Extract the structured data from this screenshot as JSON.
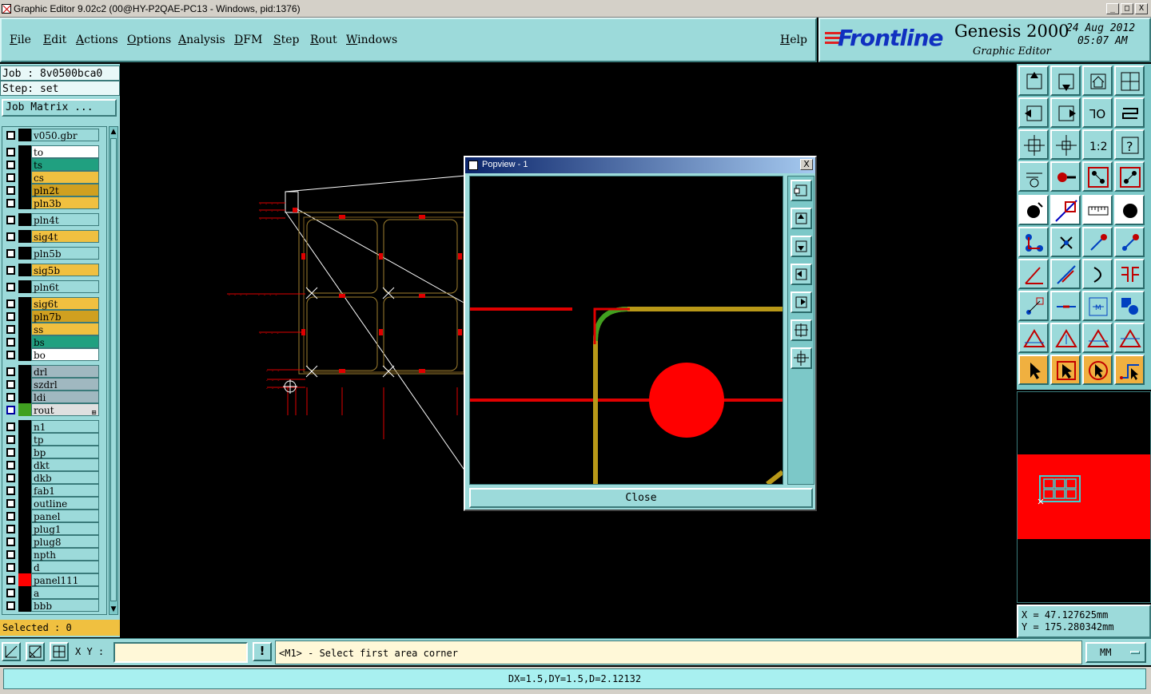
{
  "window": {
    "title": "Graphic Editor 9.02c2 (00@HY-P2QAE-PC13 - Windows, pid:1376)",
    "min": "_",
    "max": "□",
    "close": "X"
  },
  "menu": {
    "file": "File",
    "edit": "Edit",
    "actions": "Actions",
    "options": "Options",
    "analysis": "Analysis",
    "dfm": "DFM",
    "step": "Step",
    "rout": "Rout",
    "windows": "Windows",
    "help": "Help"
  },
  "brand": {
    "logo": "Frontline",
    "product": "Genesis 2000",
    "subtitle": "Graphic Editor",
    "date": "24 Aug 2012",
    "time": "05:07 AM"
  },
  "job": {
    "job_line": "Job : 8v0500bca0",
    "step_line": "Step: set",
    "matrix_button": "Job Matrix ..."
  },
  "layers": [
    {
      "name": "v050.gbr",
      "bg": "#9cdada",
      "swatch": "#000000"
    },
    {
      "name": "to",
      "bg": "#ffffff",
      "swatch": "#000000"
    },
    {
      "name": "ts",
      "bg": "#20a080",
      "swatch": "#000000"
    },
    {
      "name": "cs",
      "bg": "#f0c040",
      "swatch": "#000000"
    },
    {
      "name": "pln2t",
      "bg": "#d0a020",
      "swatch": "#000000"
    },
    {
      "name": "pln3b",
      "bg": "#f0c040",
      "swatch": "#000000"
    },
    {
      "name": "pln4t",
      "bg": "#9cdada",
      "swatch": "#000000"
    },
    {
      "name": "sig4t",
      "bg": "#f0c040",
      "swatch": "#000000"
    },
    {
      "name": "pln5b",
      "bg": "#9cdada",
      "swatch": "#000000"
    },
    {
      "name": "sig5b",
      "bg": "#f0c040",
      "swatch": "#000000"
    },
    {
      "name": "pln6t",
      "bg": "#9cdada",
      "swatch": "#000000"
    },
    {
      "name": "sig6t",
      "bg": "#f0c040",
      "swatch": "#000000"
    },
    {
      "name": "pln7b",
      "bg": "#d0a020",
      "swatch": "#000000"
    },
    {
      "name": "ss",
      "bg": "#f0c040",
      "swatch": "#000000"
    },
    {
      "name": "bs",
      "bg": "#20a080",
      "swatch": "#000000"
    },
    {
      "name": "bo",
      "bg": "#ffffff",
      "swatch": "#000000"
    },
    {
      "name": "drl",
      "bg": "#a0b8c0",
      "swatch": "#000000"
    },
    {
      "name": "szdrl",
      "bg": "#a0b8c0",
      "swatch": "#000000"
    },
    {
      "name": "ldi",
      "bg": "#a0b8c0",
      "swatch": "#000000"
    },
    {
      "name": "rout",
      "bg": "#e0e0e0",
      "swatch": "#40a020",
      "active": true
    },
    {
      "name": "n1",
      "bg": "#9cdada",
      "swatch": "#000000"
    },
    {
      "name": "tp",
      "bg": "#9cdada",
      "swatch": "#000000"
    },
    {
      "name": "bp",
      "bg": "#9cdada",
      "swatch": "#000000"
    },
    {
      "name": "dkt",
      "bg": "#9cdada",
      "swatch": "#000000"
    },
    {
      "name": "dkb",
      "bg": "#9cdada",
      "swatch": "#000000"
    },
    {
      "name": "fab1",
      "bg": "#9cdada",
      "swatch": "#000000"
    },
    {
      "name": "outline",
      "bg": "#9cdada",
      "swatch": "#000000"
    },
    {
      "name": "panel",
      "bg": "#9cdada",
      "swatch": "#000000"
    },
    {
      "name": "plug1",
      "bg": "#9cdada",
      "swatch": "#000000"
    },
    {
      "name": "plug8",
      "bg": "#9cdada",
      "swatch": "#000000"
    },
    {
      "name": "npth",
      "bg": "#9cdada",
      "swatch": "#000000"
    },
    {
      "name": "d",
      "bg": "#9cdada",
      "swatch": "#000000"
    },
    {
      "name": "panel111",
      "bg": "#9cdada",
      "swatch": "#ff0000"
    },
    {
      "name": "a",
      "bg": "#9cdada",
      "swatch": "#000000"
    },
    {
      "name": "bbb",
      "bg": "#9cdada",
      "swatch": "#000000"
    }
  ],
  "selected": "Selected : 0",
  "popview": {
    "title": "Popview - 1",
    "close_x": "X",
    "close_button": "Close"
  },
  "coords": {
    "x_line": "X = 47.127625mm",
    "y_line": "Y = 175.280342mm"
  },
  "bottom": {
    "xy_label": "X Y :",
    "xy_value": "",
    "warn": "!",
    "prompt": "<M1> - Select first area corner",
    "units": "MM"
  },
  "status": "DX=1.5,DY=1.5,D=2.12132",
  "colors": {
    "panel": "#9cdada",
    "red": "#ff0000",
    "trace": "#c0a020",
    "green": "#40a020"
  }
}
